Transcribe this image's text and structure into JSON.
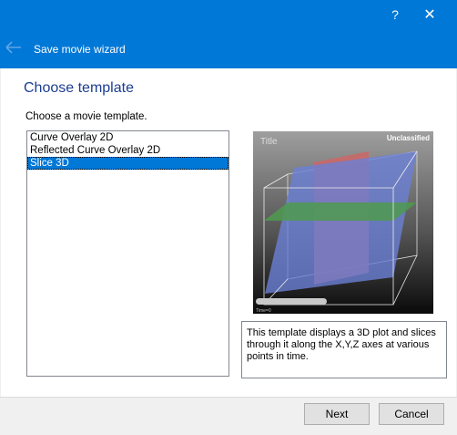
{
  "window": {
    "help_label": "?",
    "close_label": "✕",
    "wizard_title": "Save movie wizard"
  },
  "page": {
    "heading": "Choose template",
    "prompt": "Choose a movie template."
  },
  "templates": [
    {
      "label": "Curve Overlay 2D",
      "selected": false
    },
    {
      "label": "Reflected Curve Overlay 2D",
      "selected": false
    },
    {
      "label": "Slice 3D",
      "selected": true
    }
  ],
  "preview": {
    "title": "Title",
    "classification": "Unclassified",
    "time_label": "Time=0",
    "colors": {
      "x_plane": "#cc6666",
      "y_plane": "#6c7fd4",
      "z_plane": "#4f9a4f"
    }
  },
  "description": "This template displays a 3D plot and slices through it along the X,Y,Z axes at various points in time.",
  "buttons": {
    "next": "Next",
    "cancel": "Cancel"
  },
  "colors": {
    "accent": "#0078d7",
    "heading": "#1b3d91"
  }
}
